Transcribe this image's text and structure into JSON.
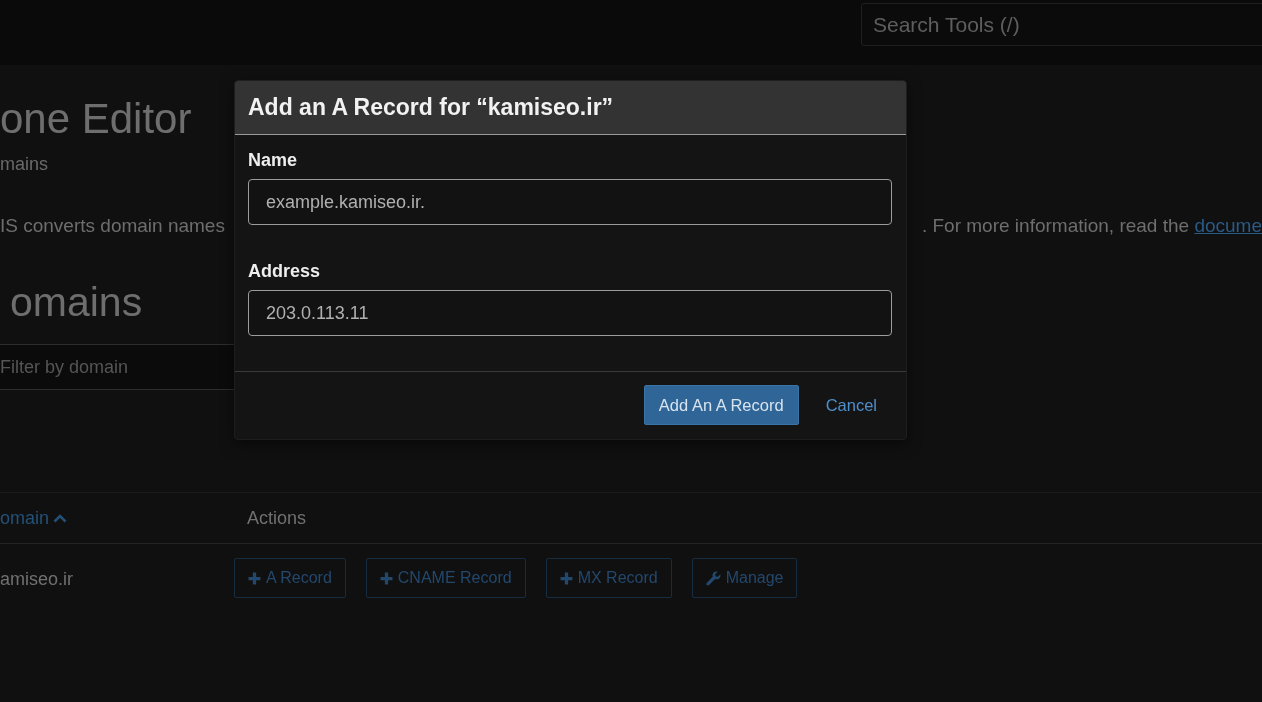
{
  "top_bar": {
    "search": {
      "placeholder": "Search Tools (/)"
    }
  },
  "page": {
    "title": "one Editor",
    "breadcrumb": "mains",
    "description": {
      "left": "IS converts domain names",
      "right": ". For more information, read the",
      "link": "docume"
    },
    "section_title": "omains",
    "filter": {
      "placeholder": "Filter by domain"
    },
    "table": {
      "columns": [
        {
          "label": "omain",
          "sorted": true
        },
        {
          "label": "Actions",
          "sorted": false
        }
      ],
      "rows": [
        {
          "domain": "amiseo.ir",
          "actions": [
            {
              "label": "A Record",
              "kind": "plus"
            },
            {
              "label": "CNAME Record",
              "kind": "plus"
            },
            {
              "label": "MX Record",
              "kind": "plus"
            },
            {
              "label": "Manage",
              "kind": "wrench"
            }
          ]
        }
      ]
    }
  },
  "modal": {
    "title": "Add an A Record for “kamiseo.ir”",
    "fields": [
      {
        "label": "Name",
        "placeholder": "example.kamiseo.ir."
      },
      {
        "label": "Address",
        "placeholder": "203.0.113.11"
      }
    ],
    "buttons": [
      {
        "label": "Add An A Record",
        "kind": "primary"
      },
      {
        "label": "Cancel",
        "kind": "link"
      }
    ]
  }
}
